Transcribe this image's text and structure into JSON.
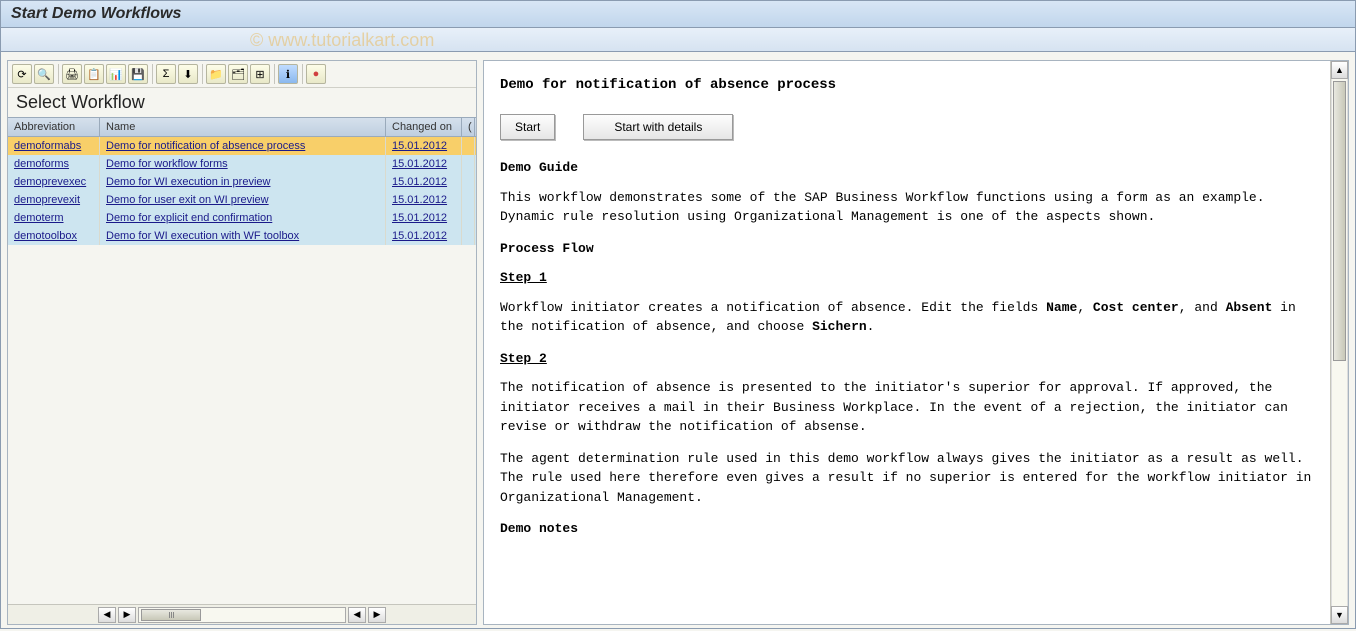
{
  "window": {
    "title": "Start Demo Workflows",
    "watermark": "© www.tutorialkart.com"
  },
  "toolbar_icons": [
    "⟳",
    "🔍",
    "🖨",
    "📋",
    "📊",
    "💾",
    "Σ",
    "⬇",
    "📁",
    "🗂",
    "⊞",
    "ℹ",
    "●"
  ],
  "left": {
    "heading": "Select Workflow",
    "cols": {
      "abbr": "Abbreviation",
      "name": "Name",
      "date": "Changed on",
      "extra": "("
    },
    "rows": [
      {
        "abbr": "demoformabs",
        "name": "Demo for notification of absence process",
        "date": "15.01.2012",
        "sel": true
      },
      {
        "abbr": "demoforms",
        "name": "Demo for workflow forms",
        "date": "15.01.2012",
        "sel": false
      },
      {
        "abbr": "demoprevexec",
        "name": "Demo for WI execution in preview",
        "date": "15.01.2012",
        "sel": false
      },
      {
        "abbr": "demoprevexit",
        "name": "Demo for user exit on WI preview",
        "date": "15.01.2012",
        "sel": false
      },
      {
        "abbr": "demoterm",
        "name": "Demo for explicit end confirmation",
        "date": "15.01.2012",
        "sel": false
      },
      {
        "abbr": "demotoolbox",
        "name": "Demo for WI execution with WF toolbox",
        "date": "15.01.2012",
        "sel": false
      }
    ]
  },
  "detail": {
    "title": "Demo for notification of absence process",
    "btn_start": "Start",
    "btn_start_details": "Start with details",
    "guide_head": "Demo Guide",
    "guide_para": "This workflow demonstrates some of the SAP Business Workflow functions using a form as an example. Dynamic rule resolution using Organizational Management is one of the aspects shown.",
    "flow_head": "Process Flow",
    "step1_head": "Step 1",
    "step1_pre": "Workflow initiator creates a notification of absence. Edit the fields ",
    "step1_f1": "Name",
    "step1_c1": ", ",
    "step1_f2": "Cost center",
    "step1_c2": ", and ",
    "step1_f3": "Absent",
    "step1_mid": " in the notification of absence, and choose ",
    "step1_act": "Sichern",
    "step1_end": ".",
    "step2_head": "Step 2",
    "step2_para": "The notification of absence is presented to the initiator's superior for approval. If approved, the initiator receives a mail in their Business Workplace. In the event of a rejection, the initiator can revise or withdraw the notification of absense.",
    "agent_para": "The agent determination rule used in this demo workflow always gives the initiator as a result as well. The rule used here therefore even gives a result if no superior is entered for the workflow initiator in Organizational Management.",
    "notes_head": "Demo notes"
  }
}
